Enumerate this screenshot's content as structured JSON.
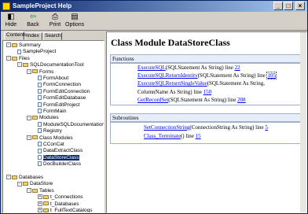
{
  "window": {
    "title": "SampleProject Help"
  },
  "titlebar_buttons": {
    "min": "_",
    "max": "□",
    "close": "×"
  },
  "toolbar": {
    "hide": "Hide",
    "back": "Back",
    "print": "Print",
    "options": "Options"
  },
  "tabs": {
    "contents": "Contents",
    "index": "Index",
    "search": "Search"
  },
  "tree": [
    {
      "label": "Summary",
      "type": "folder",
      "exp": "-"
    },
    {
      "label": "SampleProject",
      "type": "page"
    },
    {
      "label": "Files",
      "type": "folder",
      "exp": "-"
    },
    {
      "label": "SQLDocumentationTool",
      "type": "folder",
      "exp": "-"
    },
    {
      "label": "Forms",
      "type": "folder",
      "exp": "-"
    },
    {
      "label": "FormAbout",
      "type": "page"
    },
    {
      "label": "FormConnection",
      "type": "page"
    },
    {
      "label": "FormEditConnection",
      "type": "page"
    },
    {
      "label": "FormEditDatabase",
      "type": "page"
    },
    {
      "label": "FormEditProject",
      "type": "page"
    },
    {
      "label": "FormMain",
      "type": "page"
    },
    {
      "label": "Modules",
      "type": "folder",
      "exp": "-"
    },
    {
      "label": "ModuleSQLDocumentation",
      "type": "page"
    },
    {
      "label": "Registry",
      "type": "page"
    },
    {
      "label": "Class Modules",
      "type": "folder",
      "exp": "-"
    },
    {
      "label": "CConCat",
      "type": "page"
    },
    {
      "label": "DataExtractClass",
      "type": "page"
    },
    {
      "label": "DataStoreClass",
      "type": "page",
      "selected": true
    },
    {
      "label": "DocBuilderClass",
      "type": "page"
    },
    {
      "label": "",
      "type": "none"
    },
    {
      "label": "Databases",
      "type": "folder",
      "exp": "-"
    },
    {
      "label": "DataStore",
      "type": "folder",
      "exp": "-"
    },
    {
      "label": "Tables",
      "type": "folder",
      "exp": "-"
    },
    {
      "label": "t_Connections",
      "type": "folder",
      "exp": "+"
    },
    {
      "label": "t_Databases",
      "type": "folder",
      "exp": "+"
    },
    {
      "label": "t_FullTextCatalogs",
      "type": "folder",
      "exp": "+"
    }
  ],
  "content": {
    "title": "Class Module DataStoreClass",
    "functions_header": "Functions",
    "functions": [
      {
        "link": "ExecuteSQL",
        "rest": "(SQLStatement As String) line ",
        "line": "22"
      },
      {
        "link": "ExecuteSQLReturnIdentity",
        "rest": "(SQLStatement As String) line ",
        "line": "105"
      },
      {
        "link": "ExecuteSQLReturnSingleValue",
        "rest": "(SQLStatement As String,",
        "line": ""
      },
      {
        "link": "",
        "rest": "ColumnName As String) line ",
        "line": "150"
      },
      {
        "link": "GetRecordSet",
        "rest": "(SQLStatement As String) line ",
        "line": "208"
      }
    ],
    "subroutines_header": "Subroutines",
    "subroutines": [
      {
        "link": "SetConnectionString",
        "rest": "(ConnectionString As String) line ",
        "line": "5"
      },
      {
        "link": "Class_Terminate",
        "rest": "() line ",
        "line": "15"
      }
    ]
  }
}
